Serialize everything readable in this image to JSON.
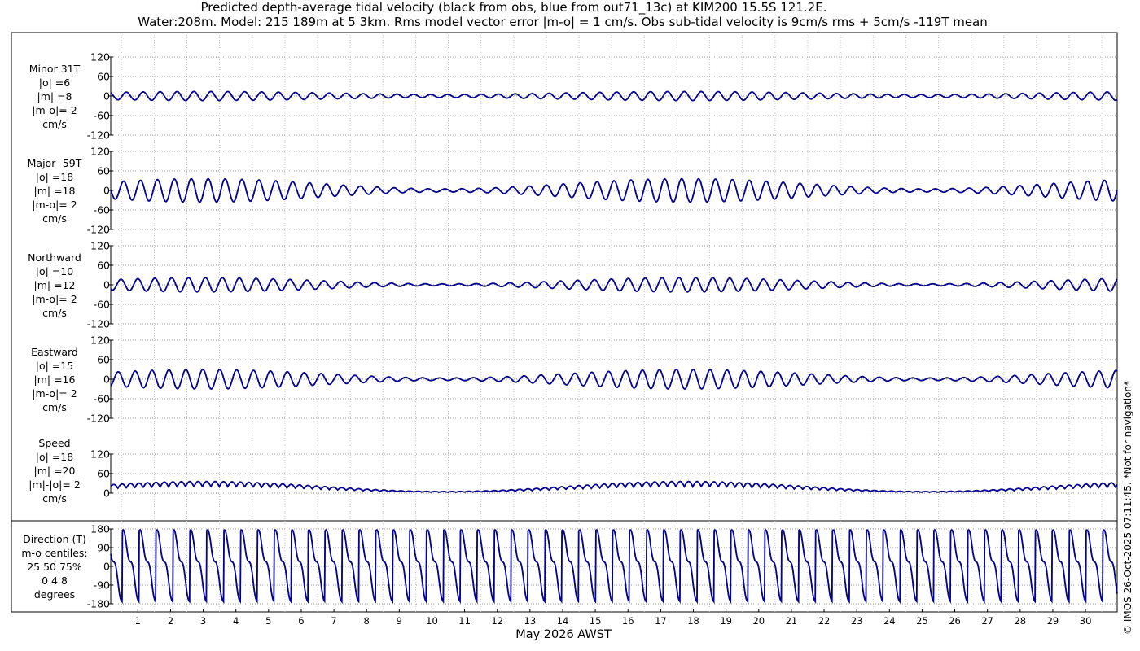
{
  "title_line1": "Predicted depth-average tidal velocity (black from obs, blue from out71_13c) at KIM200 15.5S 121.2E.",
  "title_line2": "Water:208m. Model: 215 189m at 5 3km. Rms model vector error |m-o| = 1 cm/s. Obs sub-tidal velocity is 9cm/s rms + 5cm/s -119T mean",
  "xlabel": "May 2026 AWST",
  "copyright": "© IMOS 26-Oct-2025 07:11:45. *Not for navigation*",
  "colors": {
    "obs": "#000000",
    "model": "#0000cc"
  },
  "chart_data": [
    {
      "type": "line",
      "name": "Minor 31T",
      "label_lines": [
        "Minor 31T",
        "|o| =6",
        "|m| =8",
        "|m-o|= 2",
        "cm/s"
      ],
      "ylim": [
        -120,
        120
      ],
      "yticks": [
        -120,
        -60,
        0,
        60,
        120
      ],
      "ytick_labels": [
        "-120",
        "-60",
        "0",
        "60",
        "120"
      ],
      "amplitude_range": [
        5,
        14
      ],
      "x": [
        1,
        30
      ],
      "grid": true
    },
    {
      "type": "line",
      "name": "Major -59T",
      "label_lines": [
        "Major -59T",
        "|o| =18",
        "|m| =18",
        "|m-o|= 2",
        "cm/s"
      ],
      "ylim": [
        -120,
        120
      ],
      "yticks": [
        -120,
        -60,
        0,
        60,
        120
      ],
      "ytick_labels": [
        "-120",
        "-60",
        "0",
        "60",
        "120"
      ],
      "amplitude_range": [
        5,
        36
      ],
      "x": [
        1,
        30
      ],
      "grid": true
    },
    {
      "type": "line",
      "name": "Northward",
      "label_lines": [
        "Northward",
        "|o| =10",
        "|m| =12",
        "|m-o|= 2",
        "cm/s"
      ],
      "ylim": [
        -120,
        120
      ],
      "yticks": [
        -120,
        -60,
        0,
        60,
        120
      ],
      "ytick_labels": [
        "-120",
        "-60",
        "0",
        "60",
        "120"
      ],
      "amplitude_range": [
        3,
        22
      ],
      "x": [
        1,
        30
      ],
      "grid": true
    },
    {
      "type": "line",
      "name": "Eastward",
      "label_lines": [
        "Eastward",
        "|o| =15",
        "|m| =16",
        "|m-o|= 2",
        "cm/s"
      ],
      "ylim": [
        -120,
        120
      ],
      "yticks": [
        -120,
        -60,
        0,
        60,
        120
      ],
      "ytick_labels": [
        "-120",
        "-60",
        "0",
        "60",
        "120"
      ],
      "amplitude_range": [
        4,
        30
      ],
      "x": [
        1,
        30
      ],
      "grid": true
    },
    {
      "type": "line",
      "name": "Speed",
      "label_lines": [
        "Speed",
        "|o| =18",
        "|m| =20",
        "|m|-|o|= 2",
        "cm/s"
      ],
      "ylim": [
        0,
        120
      ],
      "yticks": [
        0,
        60,
        120
      ],
      "ytick_labels": [
        "0",
        "60",
        "120"
      ],
      "amplitude_range": [
        5,
        36
      ],
      "x": [
        1,
        30
      ],
      "grid": true
    },
    {
      "type": "line",
      "name": "Direction (T)",
      "label_lines": [
        "Direction (T)",
        "m-o centiles:",
        "25  50  75%",
        "0   4   8",
        "degrees"
      ],
      "ylim": [
        -180,
        180
      ],
      "yticks": [
        -180,
        -90,
        0,
        90,
        180
      ],
      "ytick_labels": [
        "-180",
        "-90",
        "0",
        "90",
        "180"
      ],
      "x": [
        1,
        30
      ],
      "grid": true
    }
  ],
  "x_ticks": [
    "1",
    "2",
    "3",
    "4",
    "5",
    "6",
    "7",
    "8",
    "9",
    "10",
    "11",
    "12",
    "13",
    "14",
    "15",
    "16",
    "17",
    "18",
    "19",
    "20",
    "21",
    "22",
    "23",
    "24",
    "25",
    "26",
    "27",
    "28",
    "29",
    "30"
  ]
}
